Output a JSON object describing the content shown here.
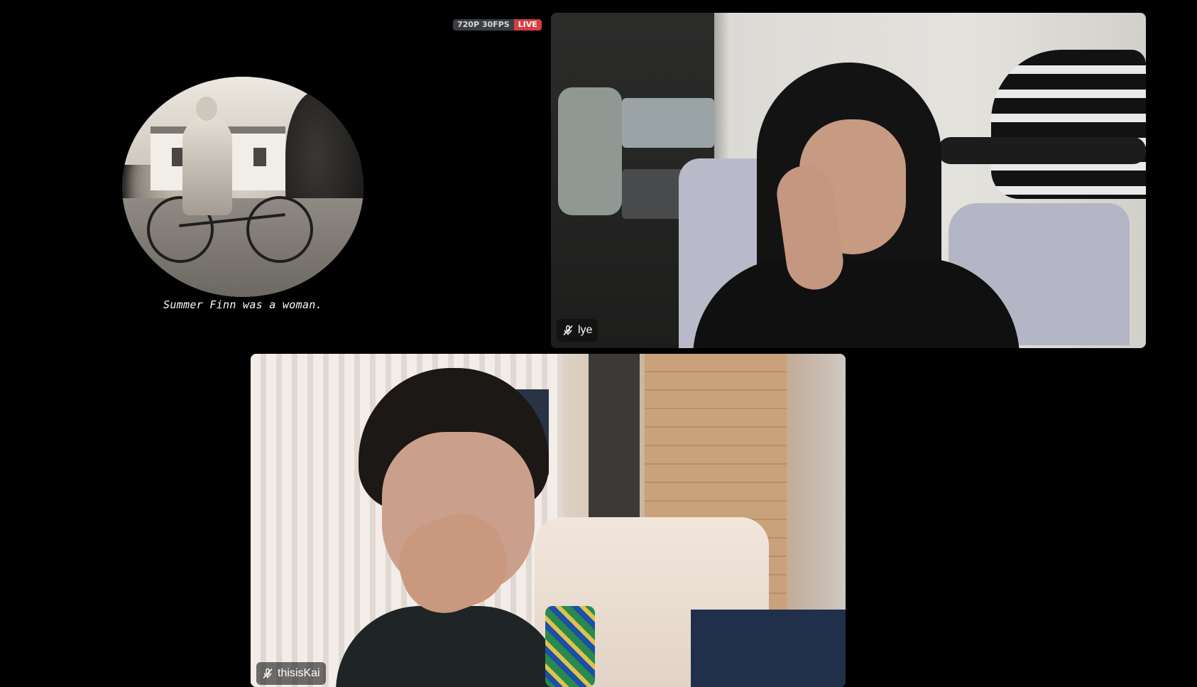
{
  "screenshare": {
    "quality_badge": "720P 30FPS",
    "live_badge": "LIVE",
    "subtitle": "Summer Finn was a woman."
  },
  "participants": [
    {
      "name": "lye",
      "muted_icon": "mic-muted-icon"
    },
    {
      "name": "thisisKai",
      "muted_icon": "mic-muted-icon"
    }
  ],
  "colors": {
    "background": "#000000",
    "live_red": "#d83c3e",
    "badge_gray": "#3a3d42"
  }
}
